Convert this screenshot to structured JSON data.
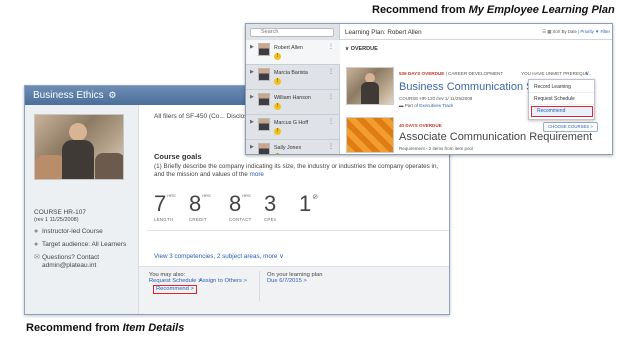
{
  "captions": {
    "top_prefix": "Recommend from ",
    "top_emphasis": "My Employee Learning Plan",
    "bottom_prefix": "Recommend from ",
    "bottom_emphasis": "Item Details"
  },
  "item_details": {
    "title": "Business Ethics",
    "title_glyph": "⚙",
    "course_code": "COURSE HR-107",
    "course_rev": "(rev 1 11/25/2008)",
    "delivery": "Instructor-led Course",
    "audience": "Target audience: All Learners",
    "questions": "Questions? Contact",
    "contact_email": "admin@plateau.int",
    "description": "All filers of SF-450 (Co... Disclosure) are require... such ethics areas as re...",
    "goals_title": "Course goals",
    "goals_text": "(1) Briefly describe the company indicating its size, the industry or industries the company operates in, and the mission and values of the",
    "goals_more": "more",
    "stats": [
      {
        "value": "7",
        "unit": "HRS",
        "label": "LENGTH"
      },
      {
        "value": "8",
        "unit": "HRS",
        "label": "CREDIT"
      },
      {
        "value": "8",
        "unit": "HRS",
        "label": "CONTACT"
      },
      {
        "value": "3",
        "unit": "",
        "label": "CPEs"
      },
      {
        "value": "1",
        "unit": "⊘",
        "label": ""
      }
    ],
    "competencies_link": "View 3 competencies, 2 subject areas, more ∨",
    "you_may_also": "You may also:",
    "request_schedule": "Request Schedule >",
    "assign_to_others": "Assign to Others >",
    "recommend": "Recommend >",
    "on_plan": "On your learning plan",
    "plan_date": "Due 6/7/2015 >"
  },
  "learning_plan": {
    "search_placeholder": "Search",
    "title": "Learning Plan: Robert Allen",
    "sort_prefix": "Sort By Date |",
    "sort_priority": "Priority",
    "filter": "▼ Filter",
    "overdue_label": "OVERDUE",
    "employees": [
      {
        "name": "Robert Allen",
        "selected": true
      },
      {
        "name": "Marcia Barista",
        "selected": false
      },
      {
        "name": "William Hanson",
        "selected": false
      },
      {
        "name": "Marcus G Hoff",
        "selected": false
      },
      {
        "name": "Sally Jones",
        "selected": false
      }
    ],
    "course1": {
      "badge": "536 DAYS OVERDUE",
      "category": "| CAREER DEVELOPMENT",
      "unmet": "YOU HAVE UNMET PREREQUI...",
      "title": "Business Communication Simulati...",
      "meta": "COURSE HR-120 /rev 1/ 11/25/2008",
      "track_prefix": "Part of",
      "track_link": "Executives Track"
    },
    "course2": {
      "badge": "40 DAYS OVERDUE",
      "title": "Associate Communication Requirement",
      "meta": "Requirement - 2 items from item pool",
      "choose": "CHOOSE COURSES >"
    },
    "menu": {
      "record": "Record Learning",
      "request": "Request Schedule",
      "recommend": "Recommend"
    }
  }
}
